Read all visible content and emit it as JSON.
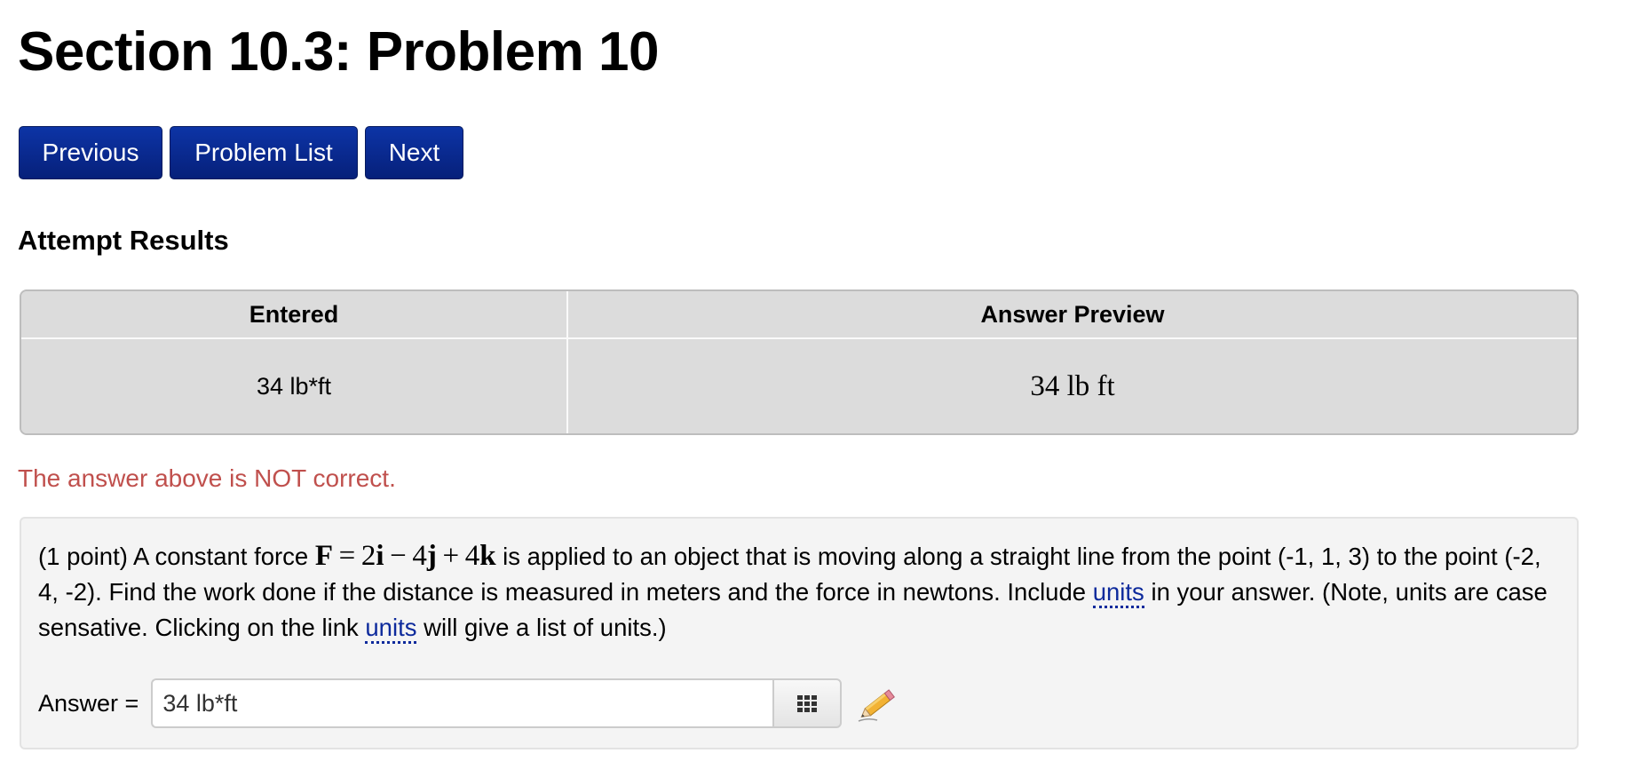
{
  "page": {
    "title": "Section 10.3: Problem 10"
  },
  "nav": {
    "previous": "Previous",
    "problem_list": "Problem List",
    "next": "Next"
  },
  "attempt": {
    "heading": "Attempt Results",
    "columns": [
      "Entered",
      "Answer Preview"
    ],
    "rows": [
      {
        "entered": "34 lb*ft",
        "preview": "34 lb ft"
      }
    ],
    "status": "The answer above is NOT correct."
  },
  "problem": {
    "intro": "(1 point) A constant force ",
    "force_expression": "F = 2i − 4j + 4k",
    "text_part1": " is applied to an object that is moving along a straight line from the point (-1, 1, 3) to the point (-2, 4, -2). Find the work done if the distance is measured in meters and the force in newtons. Include ",
    "units_link_1": "units",
    "text_part2": " in your answer. (Note, units are case sensative. Clicking on the link ",
    "units_link_2": "units",
    "text_part3": " will give a list of units.)",
    "answer_label": "Answer =",
    "answer_value": "34 lb*ft"
  },
  "icons": {
    "keypad": "keypad-grid-icon",
    "pencil": "pencil-icon"
  },
  "colors": {
    "button_bg": "#0a2b8e",
    "status_error": "#c0504d",
    "link": "#0d2a9c",
    "table_bg": "#dcdcdc",
    "problem_bg": "#f4f4f4"
  }
}
